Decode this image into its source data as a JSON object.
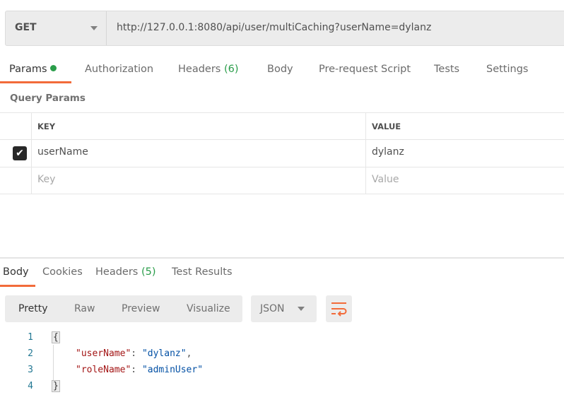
{
  "request": {
    "method": "GET",
    "url": "http://127.0.0.1:8080/api/user/multiCaching?userName=dylanz"
  },
  "request_tabs": [
    {
      "label": "Params",
      "active": true,
      "dot_color": "#2a9d4a"
    },
    {
      "label": "Authorization"
    },
    {
      "label": "Headers",
      "count": "(6)"
    },
    {
      "label": "Body"
    },
    {
      "label": "Pre-request Script"
    },
    {
      "label": "Tests"
    },
    {
      "label": "Settings"
    }
  ],
  "query_params": {
    "title": "Query Params",
    "columns": [
      "KEY",
      "VALUE"
    ],
    "rows": [
      {
        "checked": true,
        "key": "userName",
        "value": "dylanz"
      }
    ],
    "placeholder": {
      "key": "Key",
      "value": "Value"
    }
  },
  "response_tabs": [
    {
      "label": "Body",
      "active": true
    },
    {
      "label": "Cookies"
    },
    {
      "label": "Headers",
      "count": "(5)"
    },
    {
      "label": "Test Results"
    }
  ],
  "view_modes": [
    "Pretty",
    "Raw",
    "Preview",
    "Visualize"
  ],
  "format": "JSON",
  "accent_color": "#f26b3a",
  "response_body": {
    "line_numbers": [
      "1",
      "2",
      "3",
      "4"
    ],
    "open_brace": "{",
    "close_brace": "}",
    "fields": [
      {
        "key": "\"userName\"",
        "value": "\"dylanz\"",
        "trail": ","
      },
      {
        "key": "\"roleName\"",
        "value": "\"adminUser\"",
        "trail": ""
      }
    ],
    "colon": ": "
  }
}
